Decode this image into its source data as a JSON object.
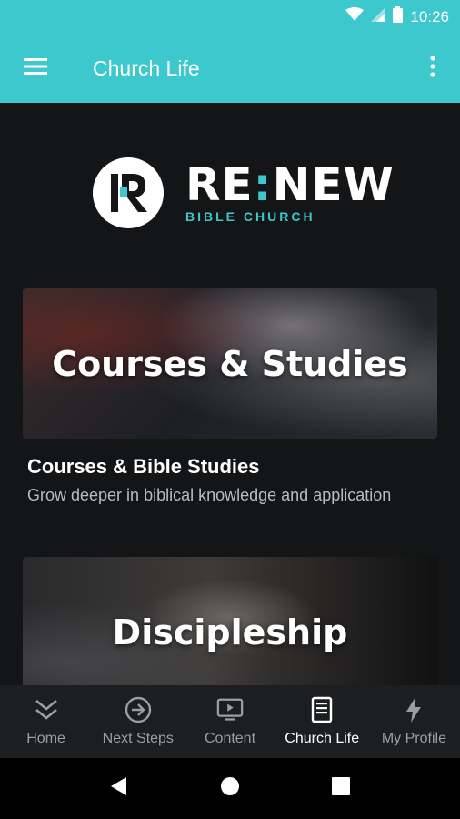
{
  "status_bar": {
    "time": "10:26",
    "icons": [
      "wifi-icon",
      "signal-icon",
      "battery-icon"
    ]
  },
  "app_bar": {
    "title": "Church Life",
    "menu_icon": "hamburger-icon",
    "overflow_icon": "more-vert-icon"
  },
  "logo": {
    "main": "RE",
    "colon": ":",
    "main_end": "NEW",
    "sub": "BIBLE CHURCH"
  },
  "cards": [
    {
      "image_title": "Courses & Studies",
      "heading": "Courses & Bible Studies",
      "description": "Grow deeper in biblical knowledge and application"
    },
    {
      "image_title": "Discipleship"
    }
  ],
  "bottom_nav": {
    "items": [
      {
        "label": "Home",
        "icon": "chevrons-down-icon",
        "active": false
      },
      {
        "label": "Next Steps",
        "icon": "circle-arrow-right-icon",
        "active": false
      },
      {
        "label": "Content",
        "icon": "play-screen-icon",
        "active": false
      },
      {
        "label": "Church Life",
        "icon": "book-icon",
        "active": true
      },
      {
        "label": "My Profile",
        "icon": "bolt-icon",
        "active": false
      }
    ]
  },
  "colors": {
    "accent": "#3cc8cc",
    "background": "#141517",
    "nav_background": "#1d1e20"
  }
}
